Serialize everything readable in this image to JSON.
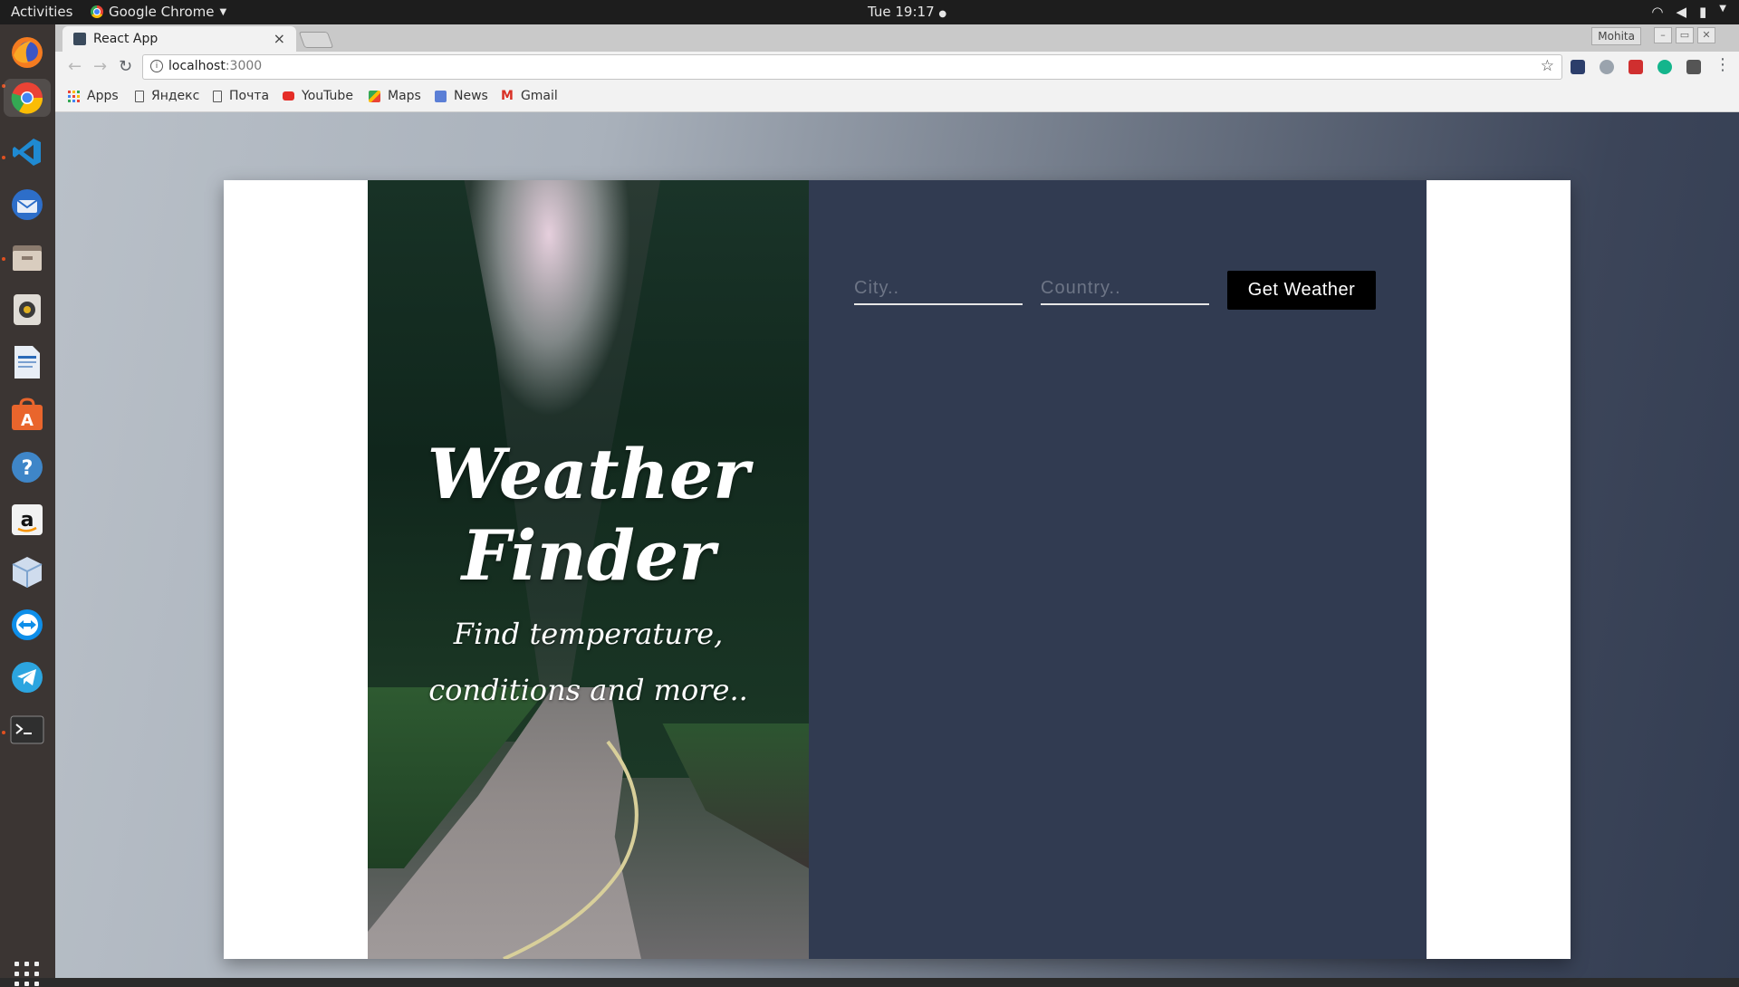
{
  "os_topbar": {
    "activities": "Activities",
    "app_menu": "Google Chrome",
    "clock": "Tue 19:17"
  },
  "dock": {
    "items": [
      "firefox",
      "chrome",
      "vscode",
      "thunderbird",
      "files",
      "rhythmbox",
      "libreoffice-writer",
      "software-center",
      "help",
      "amazon",
      "virtualbox",
      "teamviewer",
      "telegram",
      "terminal"
    ]
  },
  "browser": {
    "tab_title": "React App",
    "tab_close": "×",
    "profile_name": "Mohita",
    "url_host": "localhost",
    "url_port": ":3000",
    "bookmarks": [
      {
        "label": "Apps"
      },
      {
        "label": "Яндекс"
      },
      {
        "label": "Почта"
      },
      {
        "label": "YouTube"
      },
      {
        "label": "Maps"
      },
      {
        "label": "News"
      },
      {
        "label": "Gmail"
      }
    ]
  },
  "page": {
    "title": "Weather Finder",
    "subtitle": "Find temperature, conditions and more..",
    "form": {
      "city_placeholder": "City..",
      "country_placeholder": "Country..",
      "button_label": "Get Weather"
    }
  }
}
